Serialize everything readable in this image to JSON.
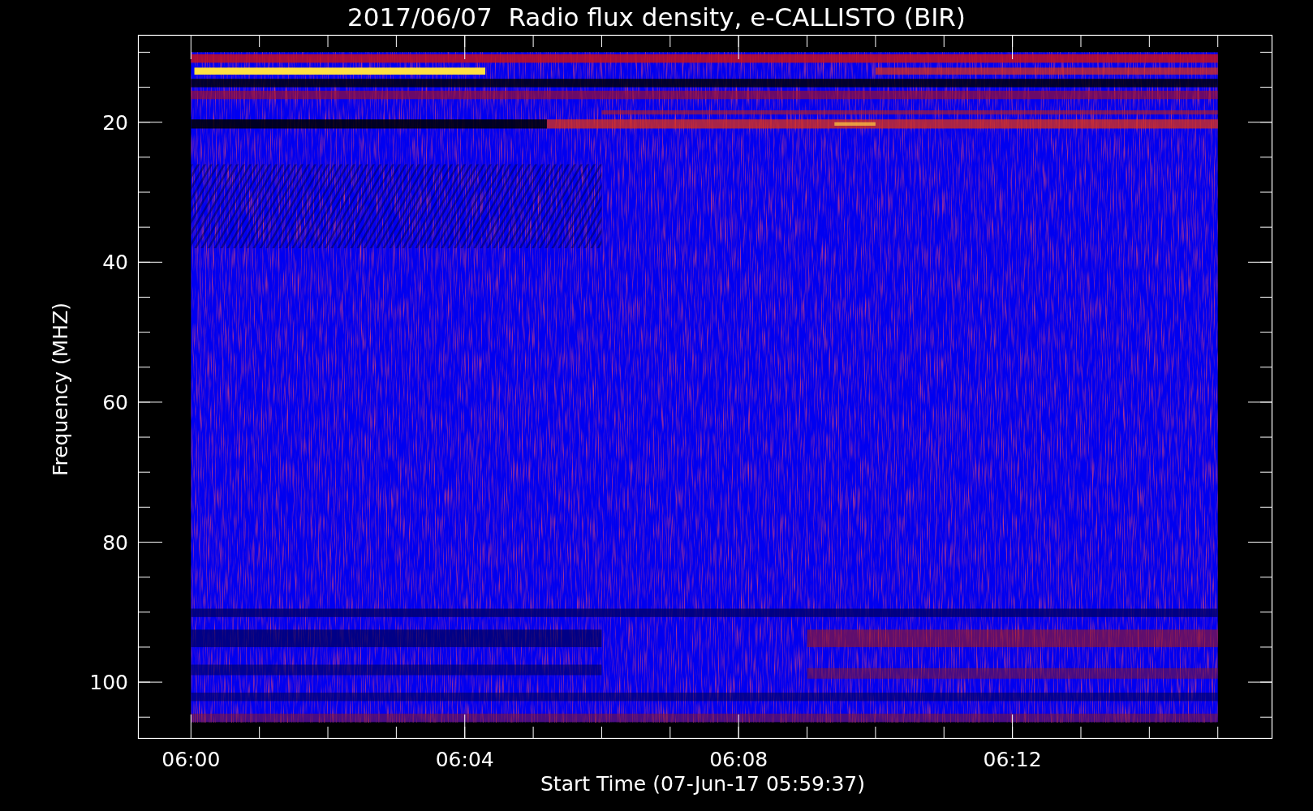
{
  "title": "2017/06/07  Radio flux density, e-CALLISTO (BIR)",
  "y_axis": {
    "label": "Frequency (MHZ)",
    "tick_labels": [
      "20",
      "40",
      "60",
      "80",
      "100"
    ]
  },
  "x_axis": {
    "label": "Start Time (07-Jun-17 05:59:37)",
    "tick_labels": [
      "06:00",
      "06:04",
      "06:08",
      "06:12"
    ]
  }
}
